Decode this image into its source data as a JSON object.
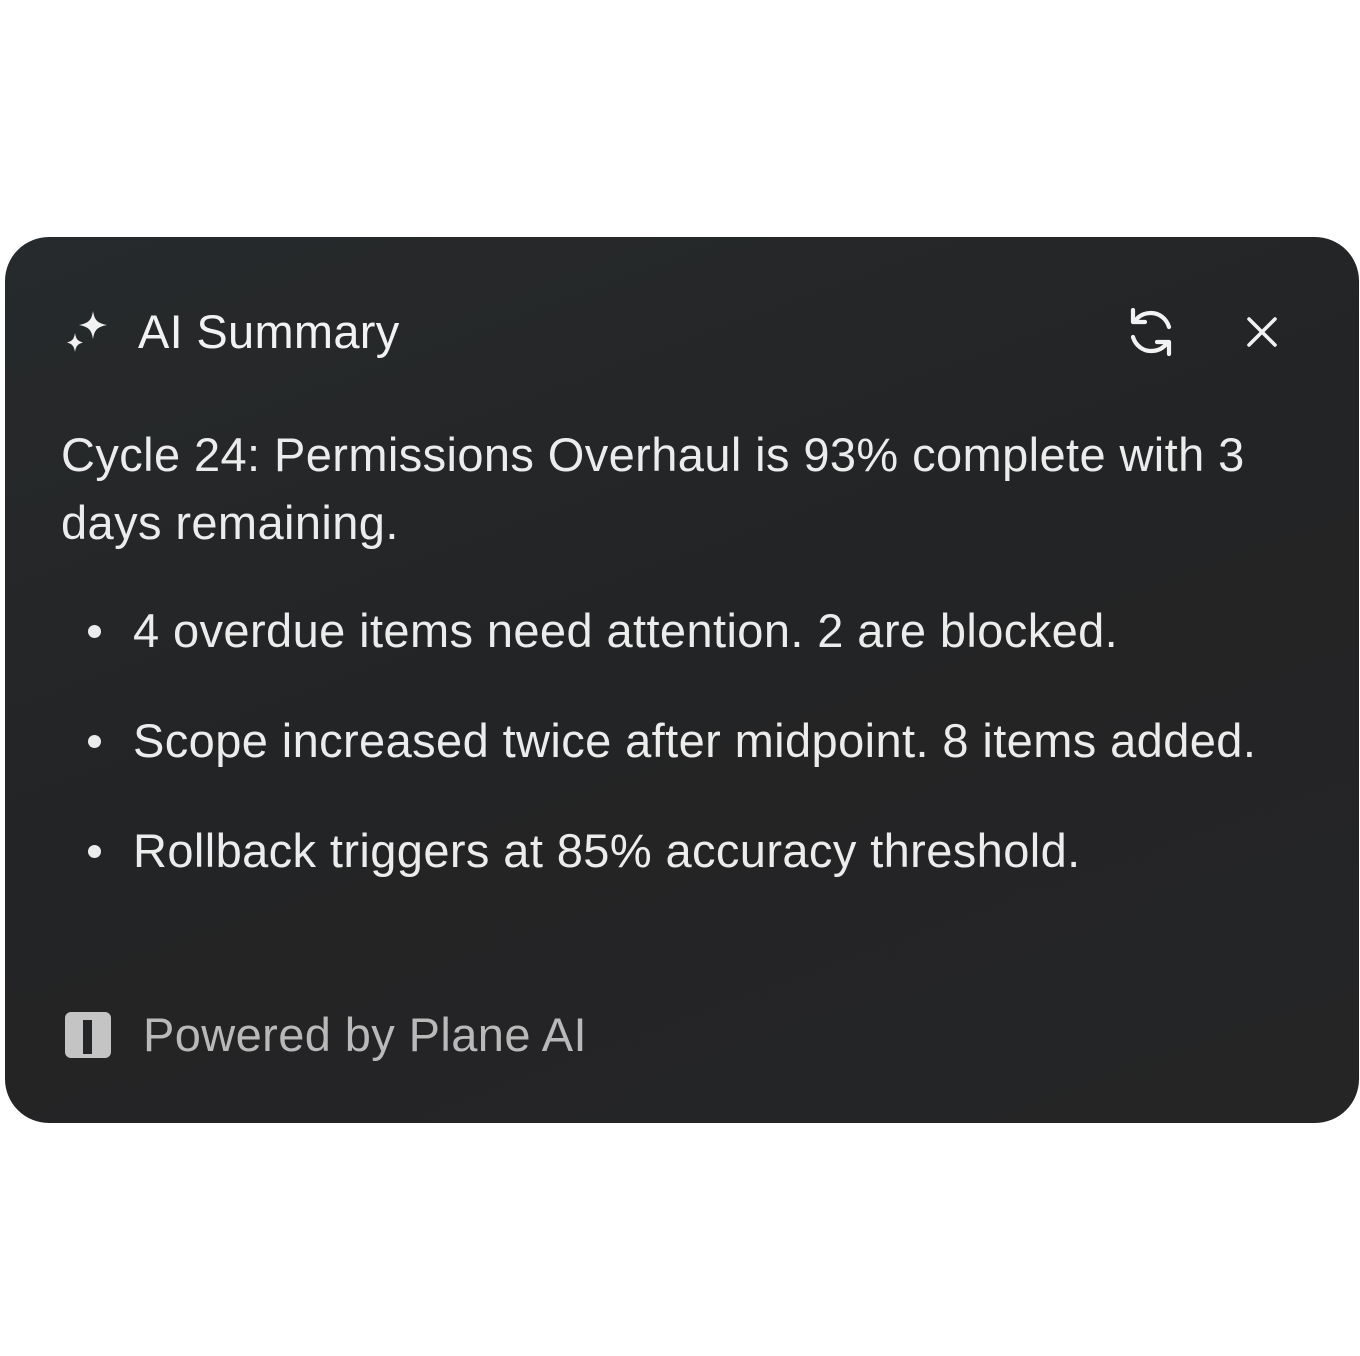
{
  "header": {
    "title": "AI Summary",
    "icon": "sparkle-icon",
    "actions": {
      "refresh_icon": "refresh-icon",
      "close_icon": "close-icon"
    }
  },
  "summary": {
    "text": "Cycle 24: Permissions Overhaul is 93% complete with 3 days remaining."
  },
  "bullets": [
    {
      "text": "4 overdue items need attention. 2 are blocked."
    },
    {
      "text": "Scope increased twice after midpoint. 8 items added."
    },
    {
      "text": "Rollback triggers at 85% accuracy threshold."
    }
  ],
  "footer": {
    "text": "Powered by Plane AI",
    "icon": "plane-logo-icon"
  },
  "colors": {
    "card_background": "#242526",
    "text_primary": "#ececec",
    "text_secondary": "#b9b9b9",
    "page_background": "#ffffff"
  }
}
